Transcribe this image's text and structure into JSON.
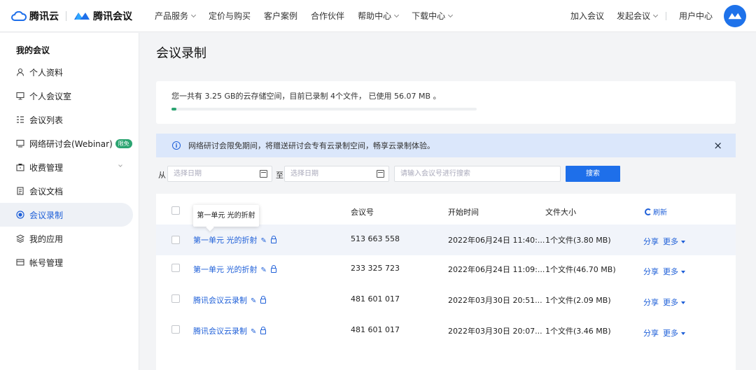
{
  "brand": {
    "cloud": "腾讯云",
    "meeting": "腾讯会议"
  },
  "nav": {
    "links": [
      {
        "label": "产品服务",
        "dropdown": true
      },
      {
        "label": "定价与购买",
        "dropdown": false
      },
      {
        "label": "客户案例",
        "dropdown": false
      },
      {
        "label": "合作伙伴",
        "dropdown": false
      },
      {
        "label": "帮助中心",
        "dropdown": true
      },
      {
        "label": "下载中心",
        "dropdown": true
      }
    ],
    "join": "加入会议",
    "start": "发起会议",
    "user_center": "用户中心"
  },
  "sidebar": {
    "title": "我的会议",
    "items": [
      {
        "label": "个人资料",
        "icon": "user-icon"
      },
      {
        "label": "个人会议室",
        "icon": "room-icon"
      },
      {
        "label": "会议列表",
        "icon": "list-icon"
      },
      {
        "label": "网络研讨会(Webinar)",
        "icon": "webinar-icon",
        "badge": "限免"
      },
      {
        "label": "收费管理",
        "icon": "billing-icon"
      },
      {
        "label": "会议文档",
        "icon": "document-icon"
      },
      {
        "label": "会议录制",
        "icon": "record-icon",
        "active": true
      },
      {
        "label": "我的应用",
        "icon": "apps-icon"
      },
      {
        "label": "帐号管理",
        "icon": "account-icon"
      }
    ]
  },
  "page": {
    "title": "会议录制"
  },
  "storage": {
    "text": "您一共有 3.25 GB的云存储空间，目前已录制 4个文件， 已使用 56.07 MB 。",
    "used_fraction": 0.017
  },
  "notice": {
    "text": "网络研讨会限免期间，将赠送研讨会专有云录制空间，畅享云录制体验。",
    "close": "×"
  },
  "filter": {
    "from": "从",
    "to": "至",
    "date_placeholder": "选择日期",
    "search_placeholder": "请输入会议号进行搜索",
    "search_button": "搜索"
  },
  "table": {
    "headers": {
      "meeting_id": "会议号",
      "start_time": "开始时间",
      "file_size": "文件大小",
      "refresh": "刷新"
    },
    "share": "分享",
    "more": "更多",
    "rows": [
      {
        "name": "第一单元 光的折射",
        "meeting_id": "513 663 558",
        "start_time": "2022年06月24日 11:40:...",
        "file_size": "1个文件(3.80 MB)"
      },
      {
        "name": "第一单元 光的折射",
        "meeting_id": "233 325 723",
        "start_time": "2022年06月24日 11:09:...",
        "file_size": "1个文件(46.70 MB)"
      },
      {
        "name": "腾讯会议云录制",
        "meeting_id": "481 601 017",
        "start_time": "2022年03月30日 20:51...",
        "file_size": "1个文件(2.09 MB)"
      },
      {
        "name": "腾讯会议云录制",
        "meeting_id": "481 601 017",
        "start_time": "2022年03月30日 20:07...",
        "file_size": "1个文件(3.46 MB)"
      }
    ]
  },
  "tooltip": {
    "text": "第一单元 光的折射"
  }
}
